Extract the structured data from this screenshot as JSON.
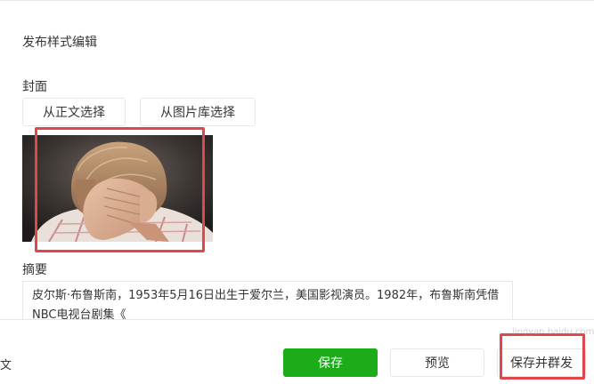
{
  "section_title": "发布样式编辑",
  "cover": {
    "label": "封面",
    "btn_from_text": "从正文选择",
    "btn_from_library": "从图片库选择",
    "image_alt": "woman covering face with hand"
  },
  "summary": {
    "label": "摘要",
    "text": "皮尔斯·布鲁斯南，1953年5月16日出生于爱尔兰，美国影视演员。1982年，布鲁斯南凭借NBC电视台剧集《"
  },
  "footer": {
    "left_text": "文",
    "save_label": "保存",
    "preview_label": "预览",
    "publish_label": "保存并群发"
  },
  "watermark": "jingyan.baidu.com",
  "colors": {
    "accent_green": "#1aad19",
    "highlight_red": "#e0474a"
  }
}
